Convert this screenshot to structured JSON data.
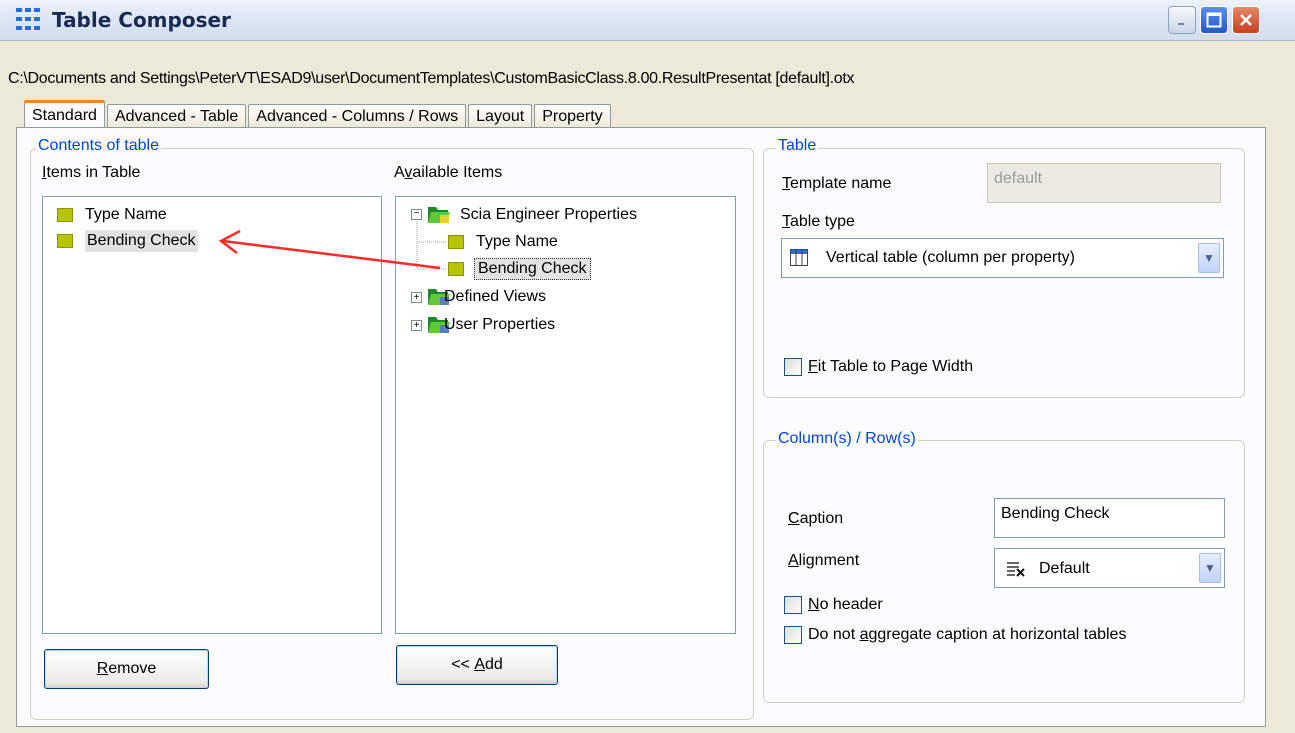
{
  "window": {
    "title": "Table Composer",
    "controls": [
      "minimize",
      "maximize",
      "close"
    ]
  },
  "file_path": "C:\\Documents and Settings\\PeterVT\\ESAD9\\user\\DocumentTemplates\\CustomBasicClass.8.00.ResultPresentat [default].otx",
  "tabs": [
    {
      "label": "Standard",
      "active": true
    },
    {
      "label": "Advanced - Table",
      "active": false
    },
    {
      "label": "Advanced - Columns / Rows",
      "active": false
    },
    {
      "label": "Layout",
      "active": false
    },
    {
      "label": "Property",
      "active": false
    }
  ],
  "contents": {
    "legend": "Contents of table",
    "items_label_mn": "I",
    "items_label_rest": "tems in Table",
    "items": [
      "Type Name",
      "Bending Check"
    ],
    "selected_item": "Bending Check",
    "available_label_pre": "A",
    "available_label_mn": "v",
    "available_label_rest": "ailable Items",
    "tree": {
      "root": "Scia Engineer Properties",
      "children": [
        "Type Name",
        "Bending Check"
      ],
      "selected": "Bending Check",
      "others": [
        "Defined Views",
        "User Properties"
      ]
    },
    "remove_mn": "R",
    "remove_rest": "emove",
    "add_pre": "<< ",
    "add_mn": "A",
    "add_rest": "dd"
  },
  "table": {
    "legend": "Table",
    "template_name_mn": "T",
    "template_name_rest": "emplate name",
    "template_name_value": "default",
    "table_type_mn": "T",
    "table_type_rest": "able type",
    "table_type_value": "Vertical table (column per property)",
    "fit_mn": "F",
    "fit_rest": "it Table to Page Width",
    "fit_checked": false
  },
  "columns": {
    "legend": "Column(s) / Row(s)",
    "caption_mn": "C",
    "caption_rest": "aption",
    "caption_value": "Bending Check",
    "alignment_mn": "A",
    "alignment_rest": "lignment",
    "alignment_value": "Default",
    "no_header_mn": "N",
    "no_header_rest": "o header",
    "no_header_checked": false,
    "no_aggregate_pre": "Do not ",
    "no_aggregate_mn": "a",
    "no_aggregate_rest": "ggregate caption at horizontal tables",
    "no_aggregate_checked": false
  },
  "colors": {
    "accent": "#0046d5",
    "arrow": "#ff2a2a",
    "tab_highlight": "#e68b2c"
  }
}
